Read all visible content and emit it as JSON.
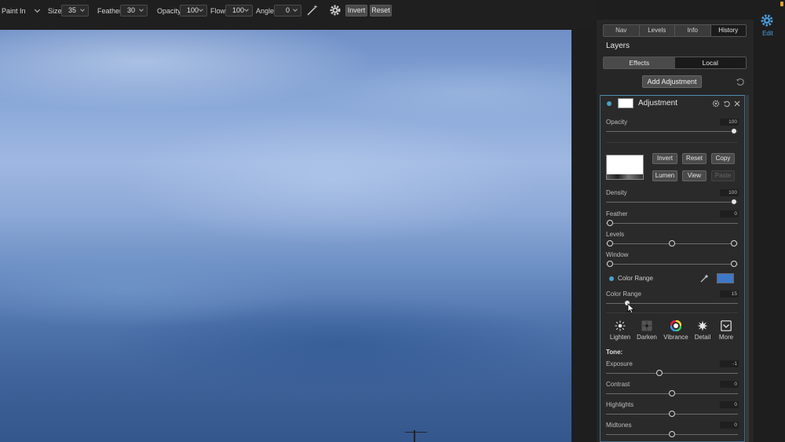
{
  "toolbar": {
    "mode": "Paint In",
    "size_label": "Size",
    "size_value": "35",
    "feather_label": "Feather",
    "feather_value": "30",
    "opacity_label": "Opacity",
    "opacity_value": "100",
    "flow_label": "Flow",
    "flow_value": "100",
    "angle_label": "Angle",
    "angle_value": "0",
    "invert_label": "Invert",
    "reset_label": "Reset",
    "icons": [
      "brush-wand-icon",
      "gear-icon"
    ]
  },
  "side_nav": {
    "edit_label": "Edit",
    "icon": "edit-gear-icon",
    "accent": "#4a9fe0"
  },
  "panel": {
    "tabs": [
      "Nav",
      "Levels",
      "Info",
      "History"
    ],
    "active_tab": "History",
    "layers_title": "Layers",
    "segments": [
      "Effects",
      "Local"
    ],
    "active_segment": "Effects",
    "add_adjustment_label": "Add Adjustment"
  },
  "layer": {
    "name": "Adjustment",
    "opacity": {
      "label": "Opacity",
      "value": "100"
    },
    "mask_buttons": [
      "Invert",
      "Reset",
      "Copy",
      "Lumen",
      "View",
      "Paste"
    ],
    "density": {
      "label": "Density",
      "value": "100"
    },
    "feather": {
      "label": "Feather",
      "value": "0"
    },
    "levels": {
      "label": "Levels"
    },
    "window": {
      "label": "Window"
    },
    "color_range_toggle": "Color Range",
    "color_range_swatch": "#3e78c8",
    "color_range": {
      "label": "Color Range",
      "value": "15"
    },
    "modes": [
      "Lighten",
      "Darken",
      "Vibrance",
      "Detail",
      "More"
    ],
    "tone_title": "Tone:",
    "exposure": {
      "label": "Exposure",
      "value": "-1"
    },
    "contrast": {
      "label": "Contrast",
      "value": "0"
    },
    "highlights": {
      "label": "Highlights",
      "value": "0"
    },
    "midtones": {
      "label": "Midtones",
      "value": "0"
    }
  }
}
